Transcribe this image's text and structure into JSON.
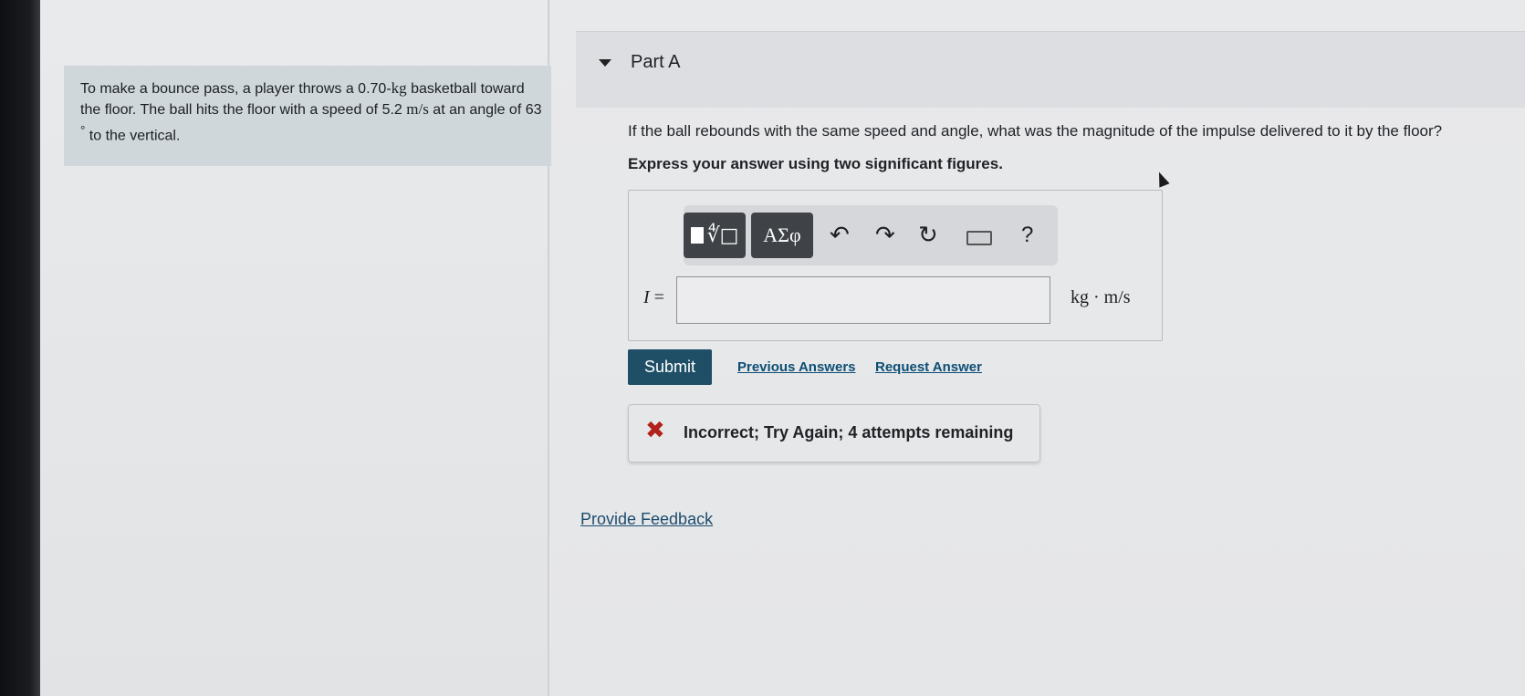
{
  "problem": {
    "text_before_mass": "To make a bounce pass, a player throws a ",
    "mass_value": "0.70",
    "mass_unit": "kg",
    "text_after_mass": " basketball toward the floor. The ball hits the floor with a speed of ",
    "speed_value": "5.2",
    "speed_unit": "m/s",
    "text_after_speed": " at an angle of ",
    "angle_value": "63",
    "angle_unit": "°",
    "text_end": " to the vertical."
  },
  "part": {
    "title": "Part A",
    "question": "If the ball rebounds with the same speed and angle, what was the magnitude of the impulse delivered to it by the floor?",
    "instruction": "Express your answer using two significant figures."
  },
  "toolbar": {
    "templates_icon": "templates-icon",
    "symbols_label": "ΑΣφ",
    "undo_icon": "↶",
    "redo_icon": "↷",
    "reset_icon": "↻",
    "help_label": "?"
  },
  "answer": {
    "variable": "I",
    "equals": " =",
    "value": "",
    "unit": "kg · m/s"
  },
  "actions": {
    "submit_label": "Submit",
    "previous_answers_label": "Previous Answers",
    "request_answer_label": "Request Answer"
  },
  "feedback": {
    "icon": "✖",
    "message": "Incorrect; Try Again; 4 attempts remaining"
  },
  "footer": {
    "provide_feedback_label": "Provide Feedback"
  },
  "colors": {
    "submit_bg": "#1f4f67",
    "incorrect_icon": "#b1221c",
    "problem_bg": "#cfd7da",
    "link": "#0d4e74"
  }
}
